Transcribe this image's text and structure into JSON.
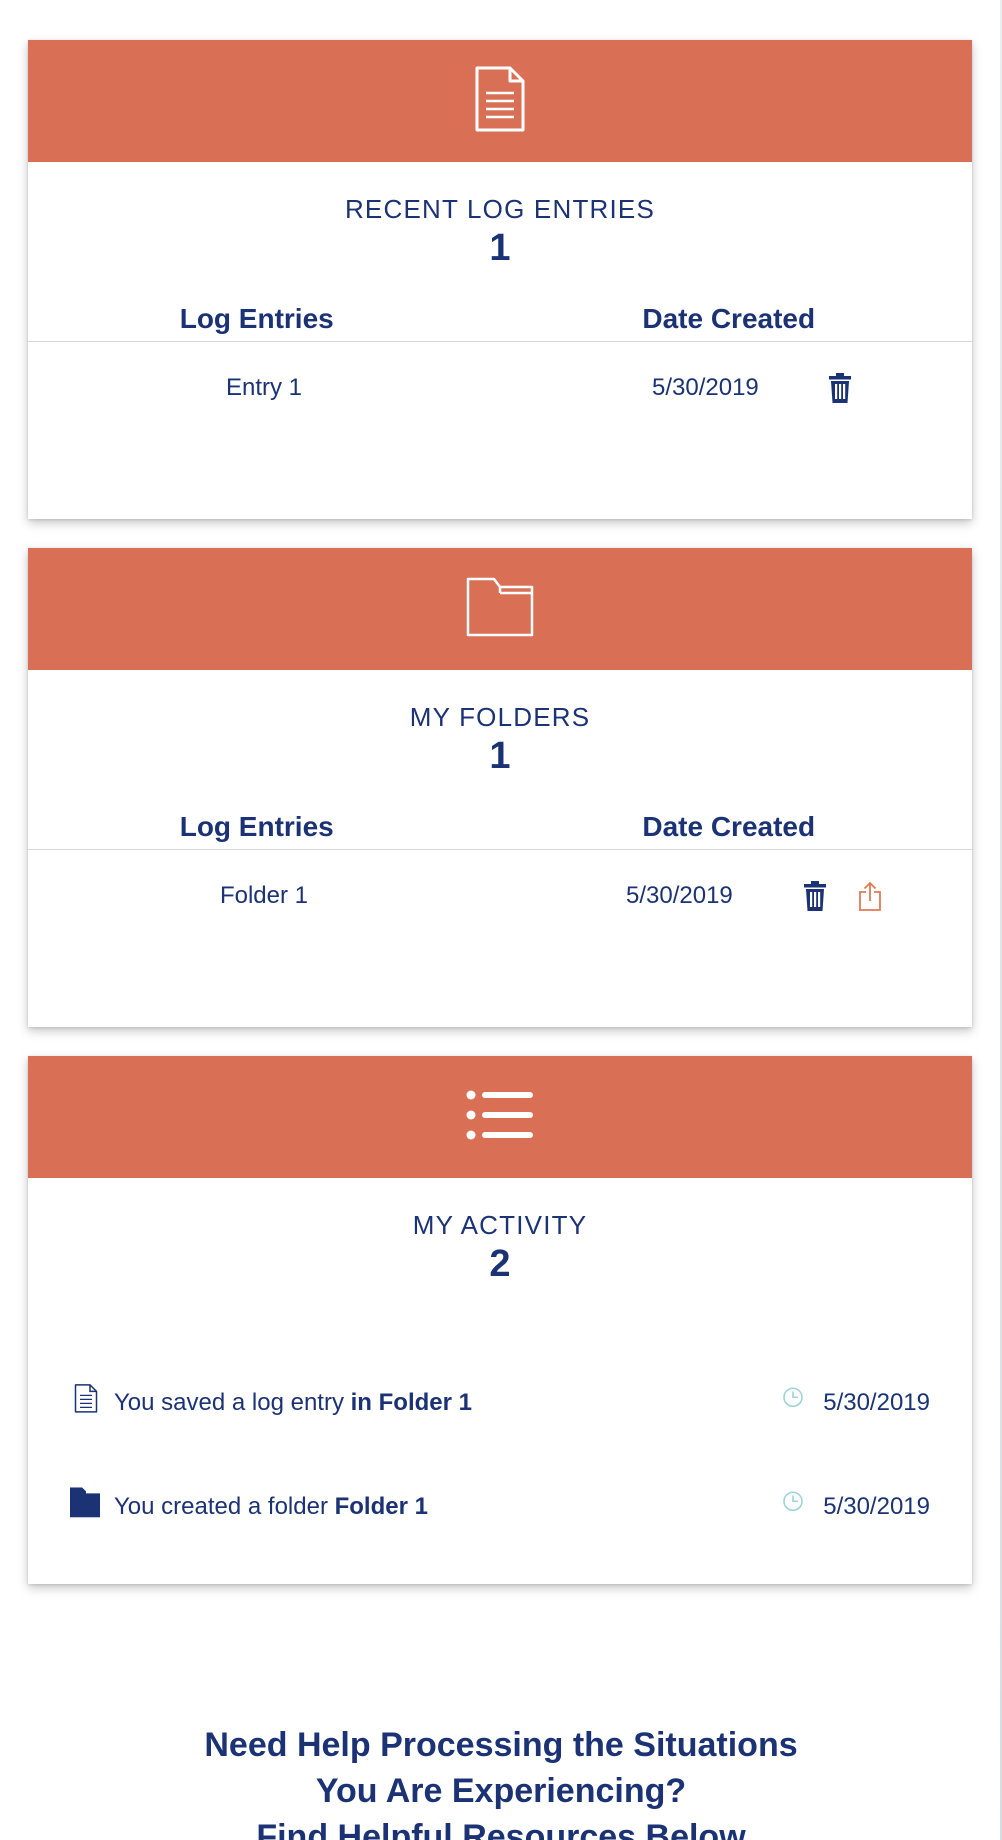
{
  "cards": {
    "recent": {
      "icon": "document-icon",
      "title": "RECENT LOG ENTRIES",
      "count": "1",
      "columns": [
        "Log Entries",
        "Date Created"
      ],
      "rows": [
        {
          "name": "Entry 1",
          "date": "5/30/2019",
          "actions": [
            "trash-icon"
          ]
        }
      ]
    },
    "folders": {
      "icon": "folder-icon",
      "title": "MY FOLDERS",
      "count": "1",
      "columns": [
        "Log Entries",
        "Date Created"
      ],
      "rows": [
        {
          "name": "Folder 1",
          "date": "5/30/2019",
          "actions": [
            "trash-icon",
            "share-icon"
          ]
        }
      ]
    },
    "activity": {
      "icon": "list-icon",
      "title": "MY ACTIVITY",
      "count": "2",
      "items": [
        {
          "icon": "document-icon",
          "text": "You saved a log entry ",
          "highlight": "in Folder 1",
          "date": "5/30/2019"
        },
        {
          "icon": "folder-filled-icon",
          "text": "You created a folder ",
          "highlight": "Folder 1",
          "date": "5/30/2019"
        }
      ]
    }
  },
  "help": {
    "line1": "Need Help Processing the Situations",
    "line2": "You Are Experiencing?",
    "line3": "Find Helpful Resources Below"
  },
  "colors": {
    "header": "#d97055",
    "text": "#1b3275",
    "clock": "#9fd3dc",
    "share": "#e07a55"
  }
}
